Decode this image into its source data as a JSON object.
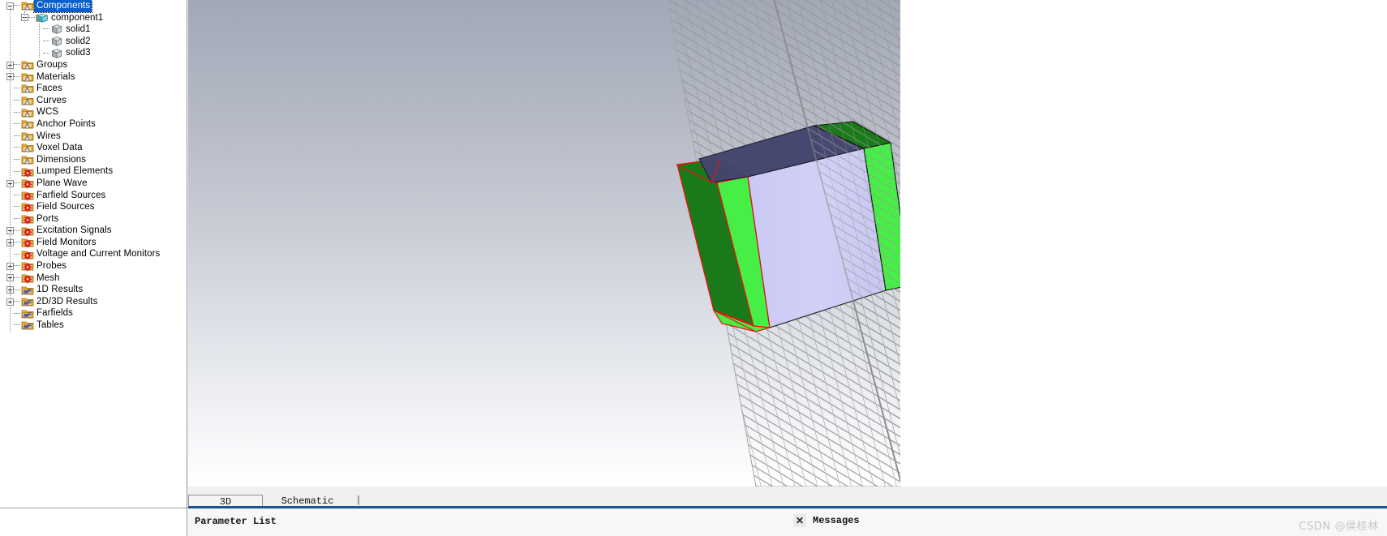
{
  "app": {
    "background_top": "#a2a8b7",
    "background_bottom": "#ffffff"
  },
  "tree": {
    "name": "navigation-tree",
    "items": [
      {
        "label": "Components",
        "depth": 0,
        "icon": "folder-cone-icon",
        "expander": "minus",
        "selected": true
      },
      {
        "label": "component1",
        "depth": 1,
        "icon": "component-cube-icon",
        "expander": "minus",
        "selected": false
      },
      {
        "label": "solid1",
        "depth": 2,
        "icon": "solid-cube-icon",
        "expander": "none",
        "selected": false
      },
      {
        "label": "solid2",
        "depth": 2,
        "icon": "solid-cube-icon",
        "expander": "none",
        "selected": false
      },
      {
        "label": "solid3",
        "depth": 2,
        "icon": "solid-cube-icon",
        "expander": "none",
        "selected": false
      },
      {
        "label": "Groups",
        "depth": 0,
        "icon": "folder-cone-icon",
        "expander": "plus",
        "selected": false
      },
      {
        "label": "Materials",
        "depth": 0,
        "icon": "folder-cone-icon",
        "expander": "plus",
        "selected": false
      },
      {
        "label": "Faces",
        "depth": 0,
        "icon": "folder-cone-icon",
        "expander": "none",
        "selected": false
      },
      {
        "label": "Curves",
        "depth": 0,
        "icon": "folder-cone-icon",
        "expander": "none",
        "selected": false
      },
      {
        "label": "WCS",
        "depth": 0,
        "icon": "folder-cone-icon",
        "expander": "none",
        "selected": false
      },
      {
        "label": "Anchor Points",
        "depth": 0,
        "icon": "folder-cone-icon",
        "expander": "none",
        "selected": false
      },
      {
        "label": "Wires",
        "depth": 0,
        "icon": "folder-cone-icon",
        "expander": "none",
        "selected": false
      },
      {
        "label": "Voxel Data",
        "depth": 0,
        "icon": "folder-cone-icon",
        "expander": "none",
        "selected": false
      },
      {
        "label": "Dimensions",
        "depth": 0,
        "icon": "folder-cone-icon",
        "expander": "none",
        "selected": false
      },
      {
        "label": "Lumped Elements",
        "depth": 0,
        "icon": "folder-gear-icon",
        "expander": "none",
        "selected": false
      },
      {
        "label": "Plane Wave",
        "depth": 0,
        "icon": "folder-gear-icon",
        "expander": "plus",
        "selected": false
      },
      {
        "label": "Farfield Sources",
        "depth": 0,
        "icon": "folder-gear-icon",
        "expander": "none",
        "selected": false
      },
      {
        "label": "Field Sources",
        "depth": 0,
        "icon": "folder-gear-icon",
        "expander": "none",
        "selected": false
      },
      {
        "label": "Ports",
        "depth": 0,
        "icon": "folder-gear-icon",
        "expander": "none",
        "selected": false
      },
      {
        "label": "Excitation Signals",
        "depth": 0,
        "icon": "folder-gear-icon",
        "expander": "plus",
        "selected": false
      },
      {
        "label": "Field Monitors",
        "depth": 0,
        "icon": "folder-gear-icon",
        "expander": "plus",
        "selected": false
      },
      {
        "label": "Voltage and Current Monitors",
        "depth": 0,
        "icon": "folder-gear-icon",
        "expander": "none",
        "selected": false
      },
      {
        "label": "Probes",
        "depth": 0,
        "icon": "folder-gear-icon",
        "expander": "plus",
        "selected": false
      },
      {
        "label": "Mesh",
        "depth": 0,
        "icon": "folder-gear-icon",
        "expander": "plus",
        "selected": false
      },
      {
        "label": "1D Results",
        "depth": 0,
        "icon": "folder-results-icon",
        "expander": "plus",
        "selected": false
      },
      {
        "label": "2D/3D Results",
        "depth": 0,
        "icon": "folder-results-icon",
        "expander": "plus",
        "selected": false
      },
      {
        "label": "Farfields",
        "depth": 0,
        "icon": "folder-results-icon",
        "expander": "none",
        "selected": false
      },
      {
        "label": "Tables",
        "depth": 0,
        "icon": "folder-results-icon",
        "expander": "none",
        "selected": false
      }
    ]
  },
  "viewport": {
    "name": "3d-viewport",
    "scene": {
      "mesh_plane_color": "#9a9a9a",
      "solid_colors": {
        "dark_green": "#1a7a1a",
        "bright_green": "#45ef45",
        "lavender": "#ccccf5",
        "slate_top": "#44456e",
        "edge_red": "#ee1111",
        "edge_black": "#101010"
      }
    }
  },
  "tabs": {
    "items": [
      {
        "label": "3D",
        "active": true
      },
      {
        "label": "Schematic",
        "active": false
      }
    ],
    "caret": "|",
    "underline_color": "#19558f"
  },
  "statusbar": {
    "parameter_list_label": "Parameter List",
    "messages_label": "Messages",
    "close_icon": "✕",
    "watermark": "CSDN @侯桂林"
  }
}
